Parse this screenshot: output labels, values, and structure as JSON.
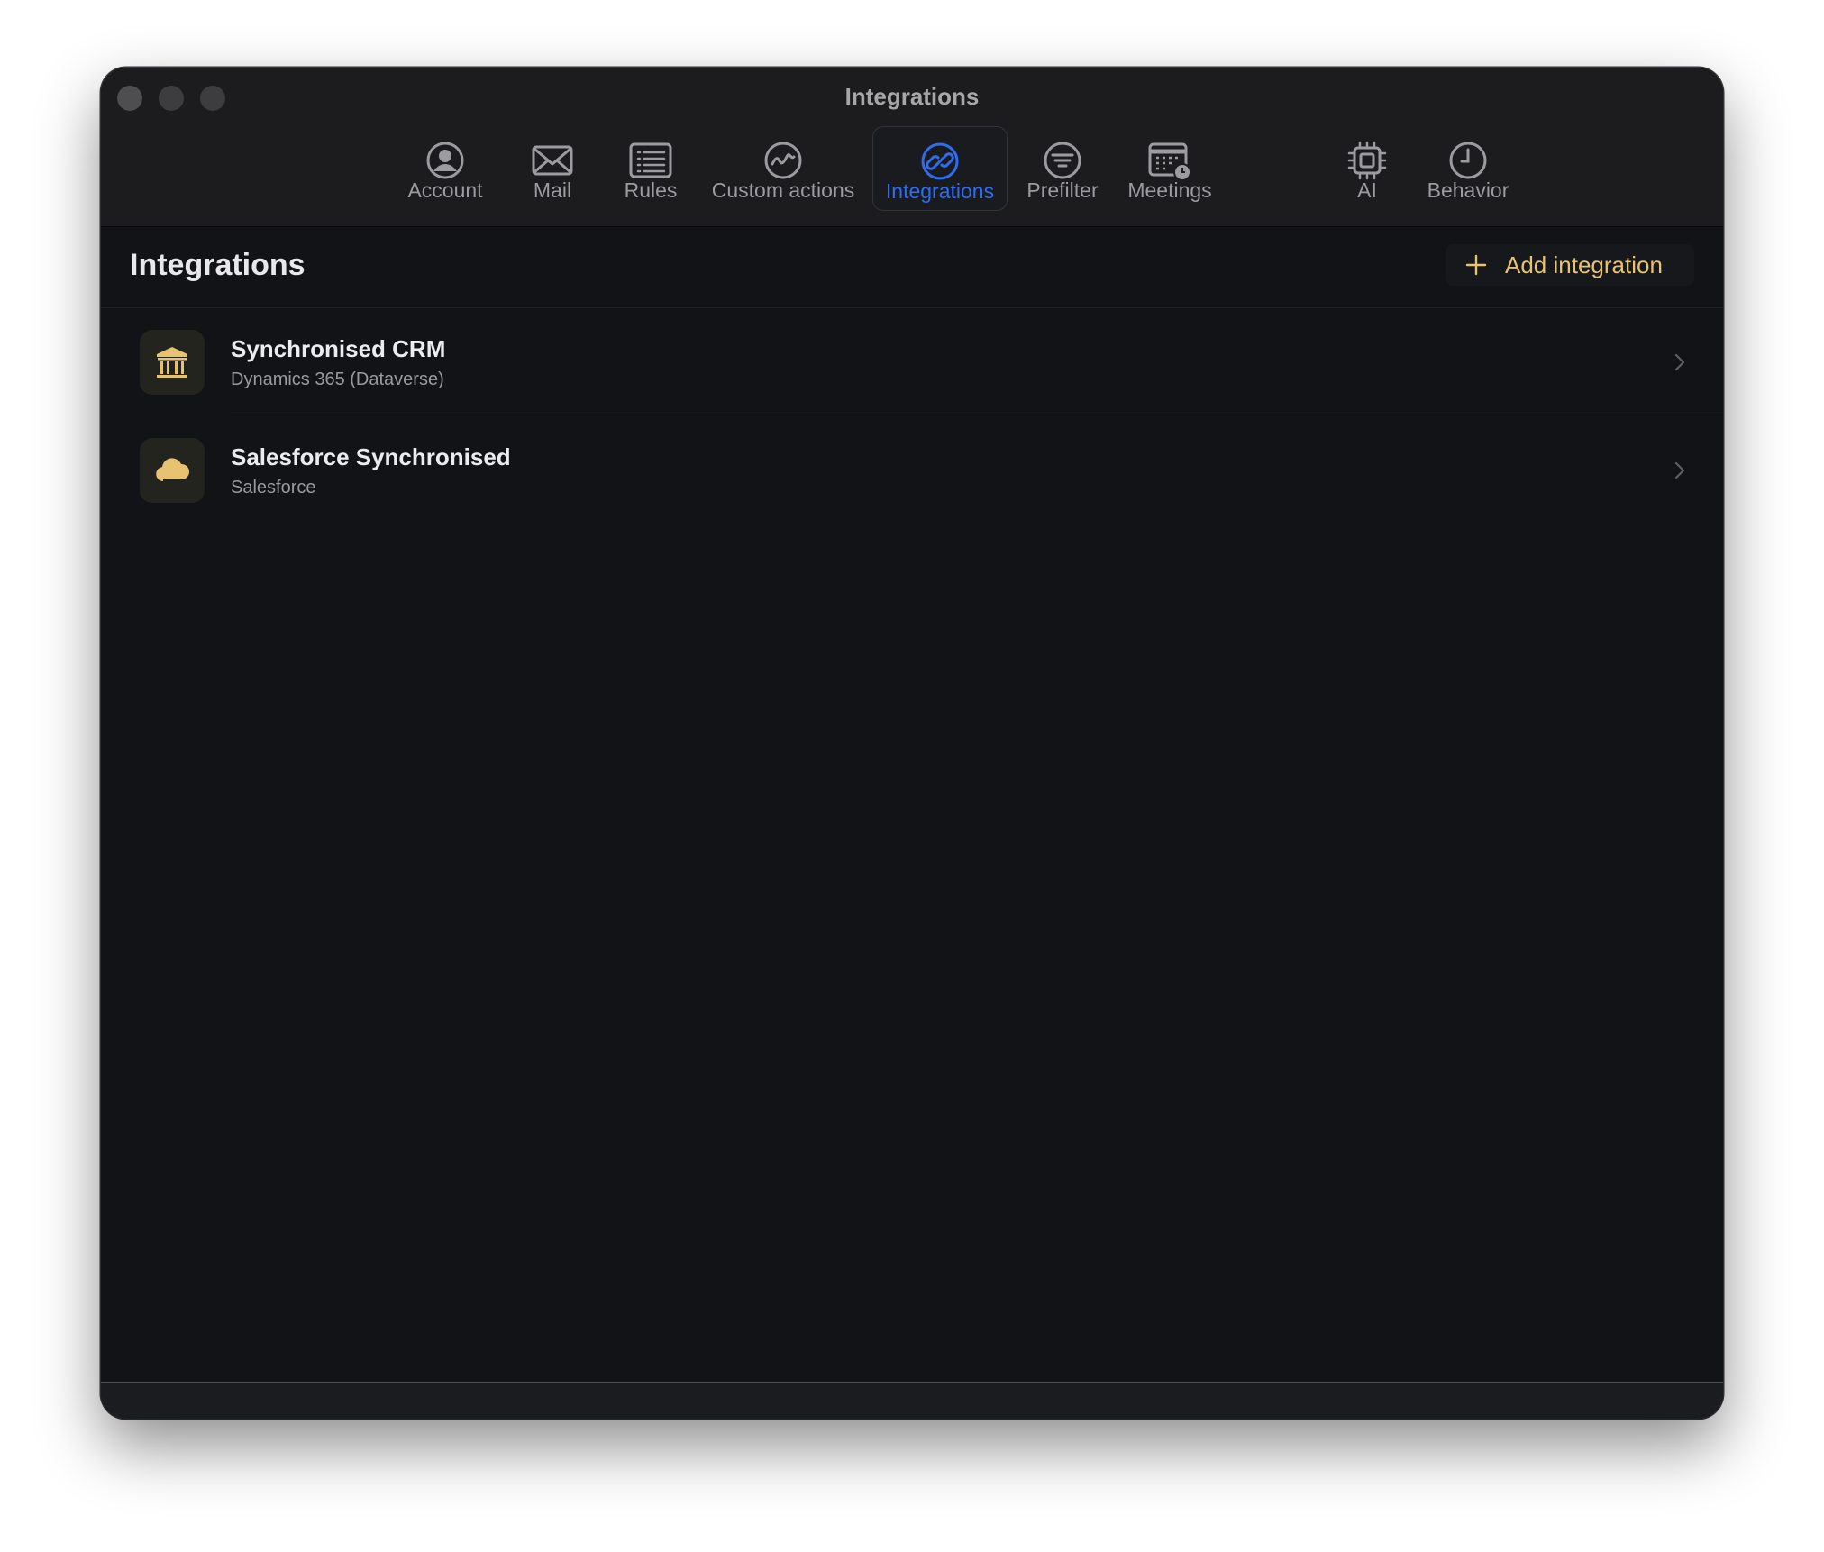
{
  "window": {
    "title": "Integrations"
  },
  "toolbar": {
    "tabs": [
      {
        "label": "Account",
        "icon": "person-circle-icon"
      },
      {
        "label": "Mail",
        "icon": "envelope-icon"
      },
      {
        "label": "Rules",
        "icon": "list-icon"
      },
      {
        "label": "Custom actions",
        "icon": "waveform-circle-icon"
      },
      {
        "label": "Integrations",
        "icon": "link-circle-icon",
        "active": true
      },
      {
        "label": "Prefilter",
        "icon": "filter-circle-icon"
      },
      {
        "label": "Meetings",
        "icon": "calendar-clock-icon"
      },
      {
        "label": "AI",
        "icon": "cpu-chip-icon"
      },
      {
        "label": "Behavior",
        "icon": "clock-icon"
      }
    ]
  },
  "main": {
    "title": "Integrations",
    "add_button_label": "Add integration",
    "integrations": [
      {
        "name": "Synchronised CRM",
        "provider": "Dynamics 365 (Dataverse)",
        "icon": "bank-building-icon"
      },
      {
        "name": "Salesforce Synchronised",
        "provider": "Salesforce",
        "icon": "cloud-icon"
      }
    ]
  },
  "colors": {
    "accent_blue": "#2f6cf0",
    "accent_gold": "#e7c270",
    "window_bg": "#121317",
    "toolbar_bg": "#1c1c1e"
  }
}
